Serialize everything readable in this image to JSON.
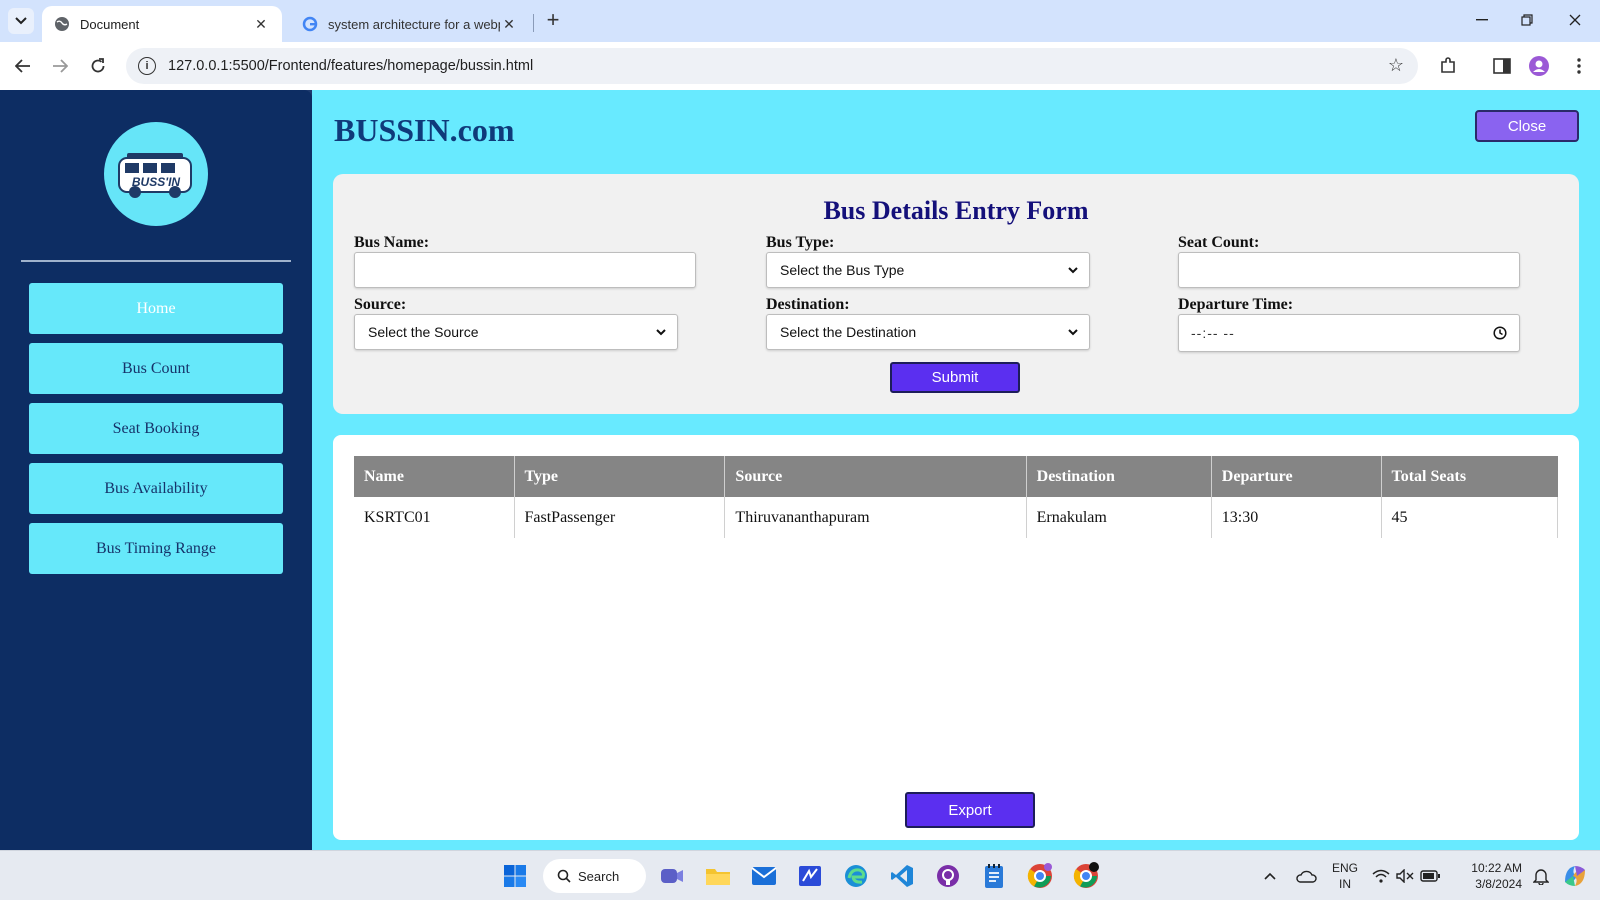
{
  "browser": {
    "tabs": [
      {
        "title": "Document",
        "active": true
      },
      {
        "title": "system architecture for a webpa",
        "active": false
      }
    ],
    "url": "127.0.0.1:5500/Frontend/features/homepage/bussin.html"
  },
  "sidebar": {
    "logo_text": "BUSS'IN",
    "items": [
      {
        "label": "Home"
      },
      {
        "label": "Bus Count"
      },
      {
        "label": "Seat Booking"
      },
      {
        "label": "Bus Availability"
      },
      {
        "label": "Bus Timing Range"
      }
    ]
  },
  "header": {
    "brand": "BUSSIN.com",
    "close_label": "Close"
  },
  "form": {
    "title": "Bus Details Entry Form",
    "bus_name_label": "Bus Name:",
    "bus_name_value": "",
    "bus_type_label": "Bus Type:",
    "bus_type_selected": "Select the Bus Type",
    "seat_count_label": "Seat Count:",
    "seat_count_value": "",
    "source_label": "Source:",
    "source_selected": "Select the Source",
    "destination_label": "Destination:",
    "destination_selected": "Select the Destination",
    "departure_label": "Departure Time:",
    "departure_placeholder": "--:-- --",
    "submit_label": "Submit"
  },
  "table": {
    "headers": [
      "Name",
      "Type",
      "Source",
      "Destination",
      "Departure",
      "Total Seats"
    ],
    "rows": [
      [
        "KSRTC01",
        "FastPassenger",
        "Thiruvananthapuram",
        "Ernakulam",
        "13:30",
        "45"
      ]
    ],
    "export_label": "Export"
  },
  "taskbar": {
    "search_label": "Search",
    "lang_line1": "ENG",
    "lang_line2": "IN",
    "time": "10:22 AM",
    "date": "3/8/2024"
  },
  "colors": {
    "accent_purple": "#5b2ff0",
    "sidebar_bg": "#0d2d63",
    "main_bg": "#68eaff"
  }
}
